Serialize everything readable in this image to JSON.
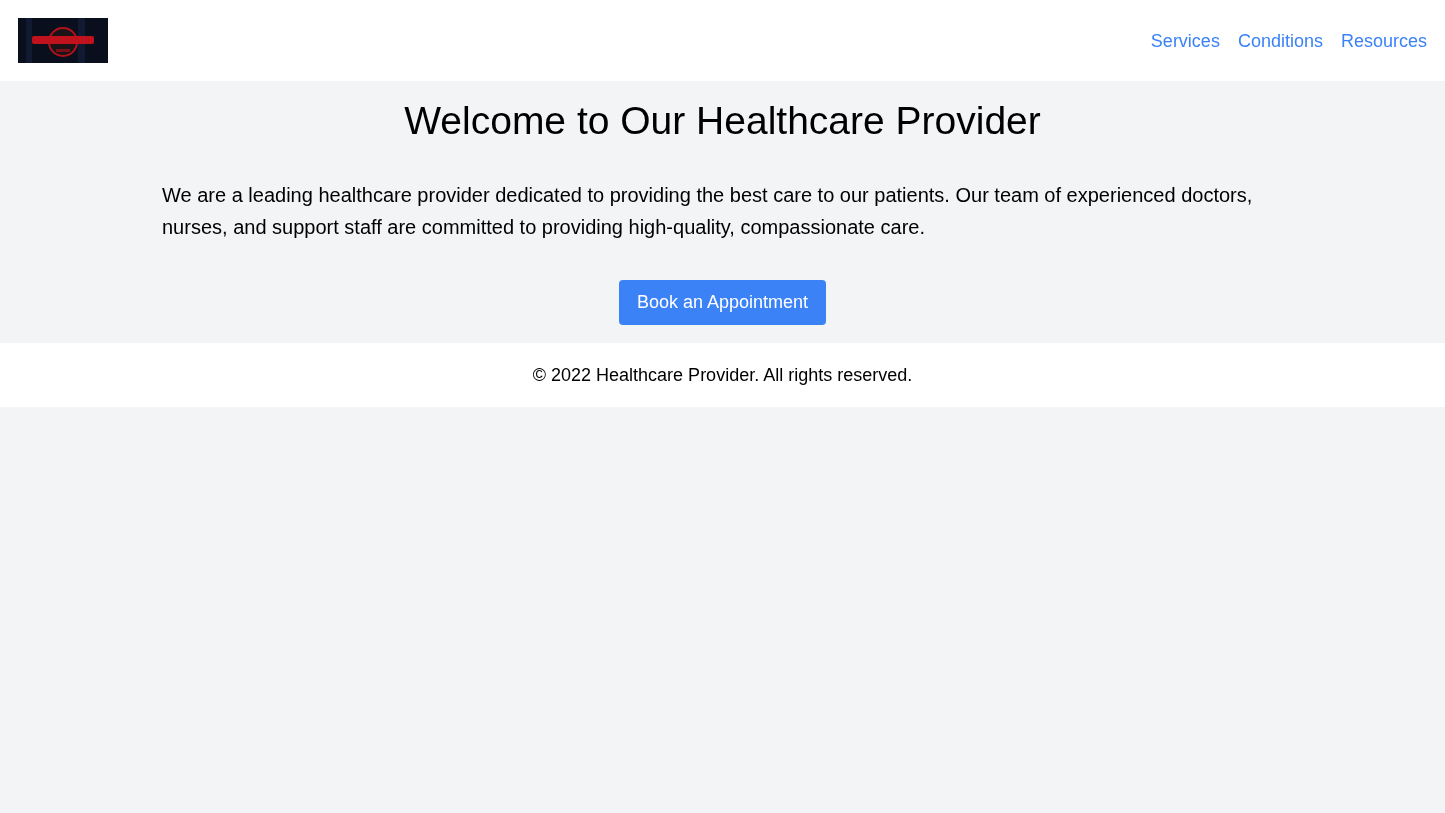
{
  "header": {
    "nav_links": [
      {
        "label": "Services"
      },
      {
        "label": "Conditions"
      },
      {
        "label": "Resources"
      }
    ]
  },
  "hero": {
    "title": "Welcome to Our Healthcare Provider",
    "description": "We are a leading healthcare provider dedicated to providing the best care to our patients. Our team of experienced doctors, nurses, and support staff are committed to providing high-quality, compassionate care.",
    "button": "Book an Appointment"
  },
  "footer": {
    "text": "© 2022 Healthcare Provider. All rights reserved."
  }
}
